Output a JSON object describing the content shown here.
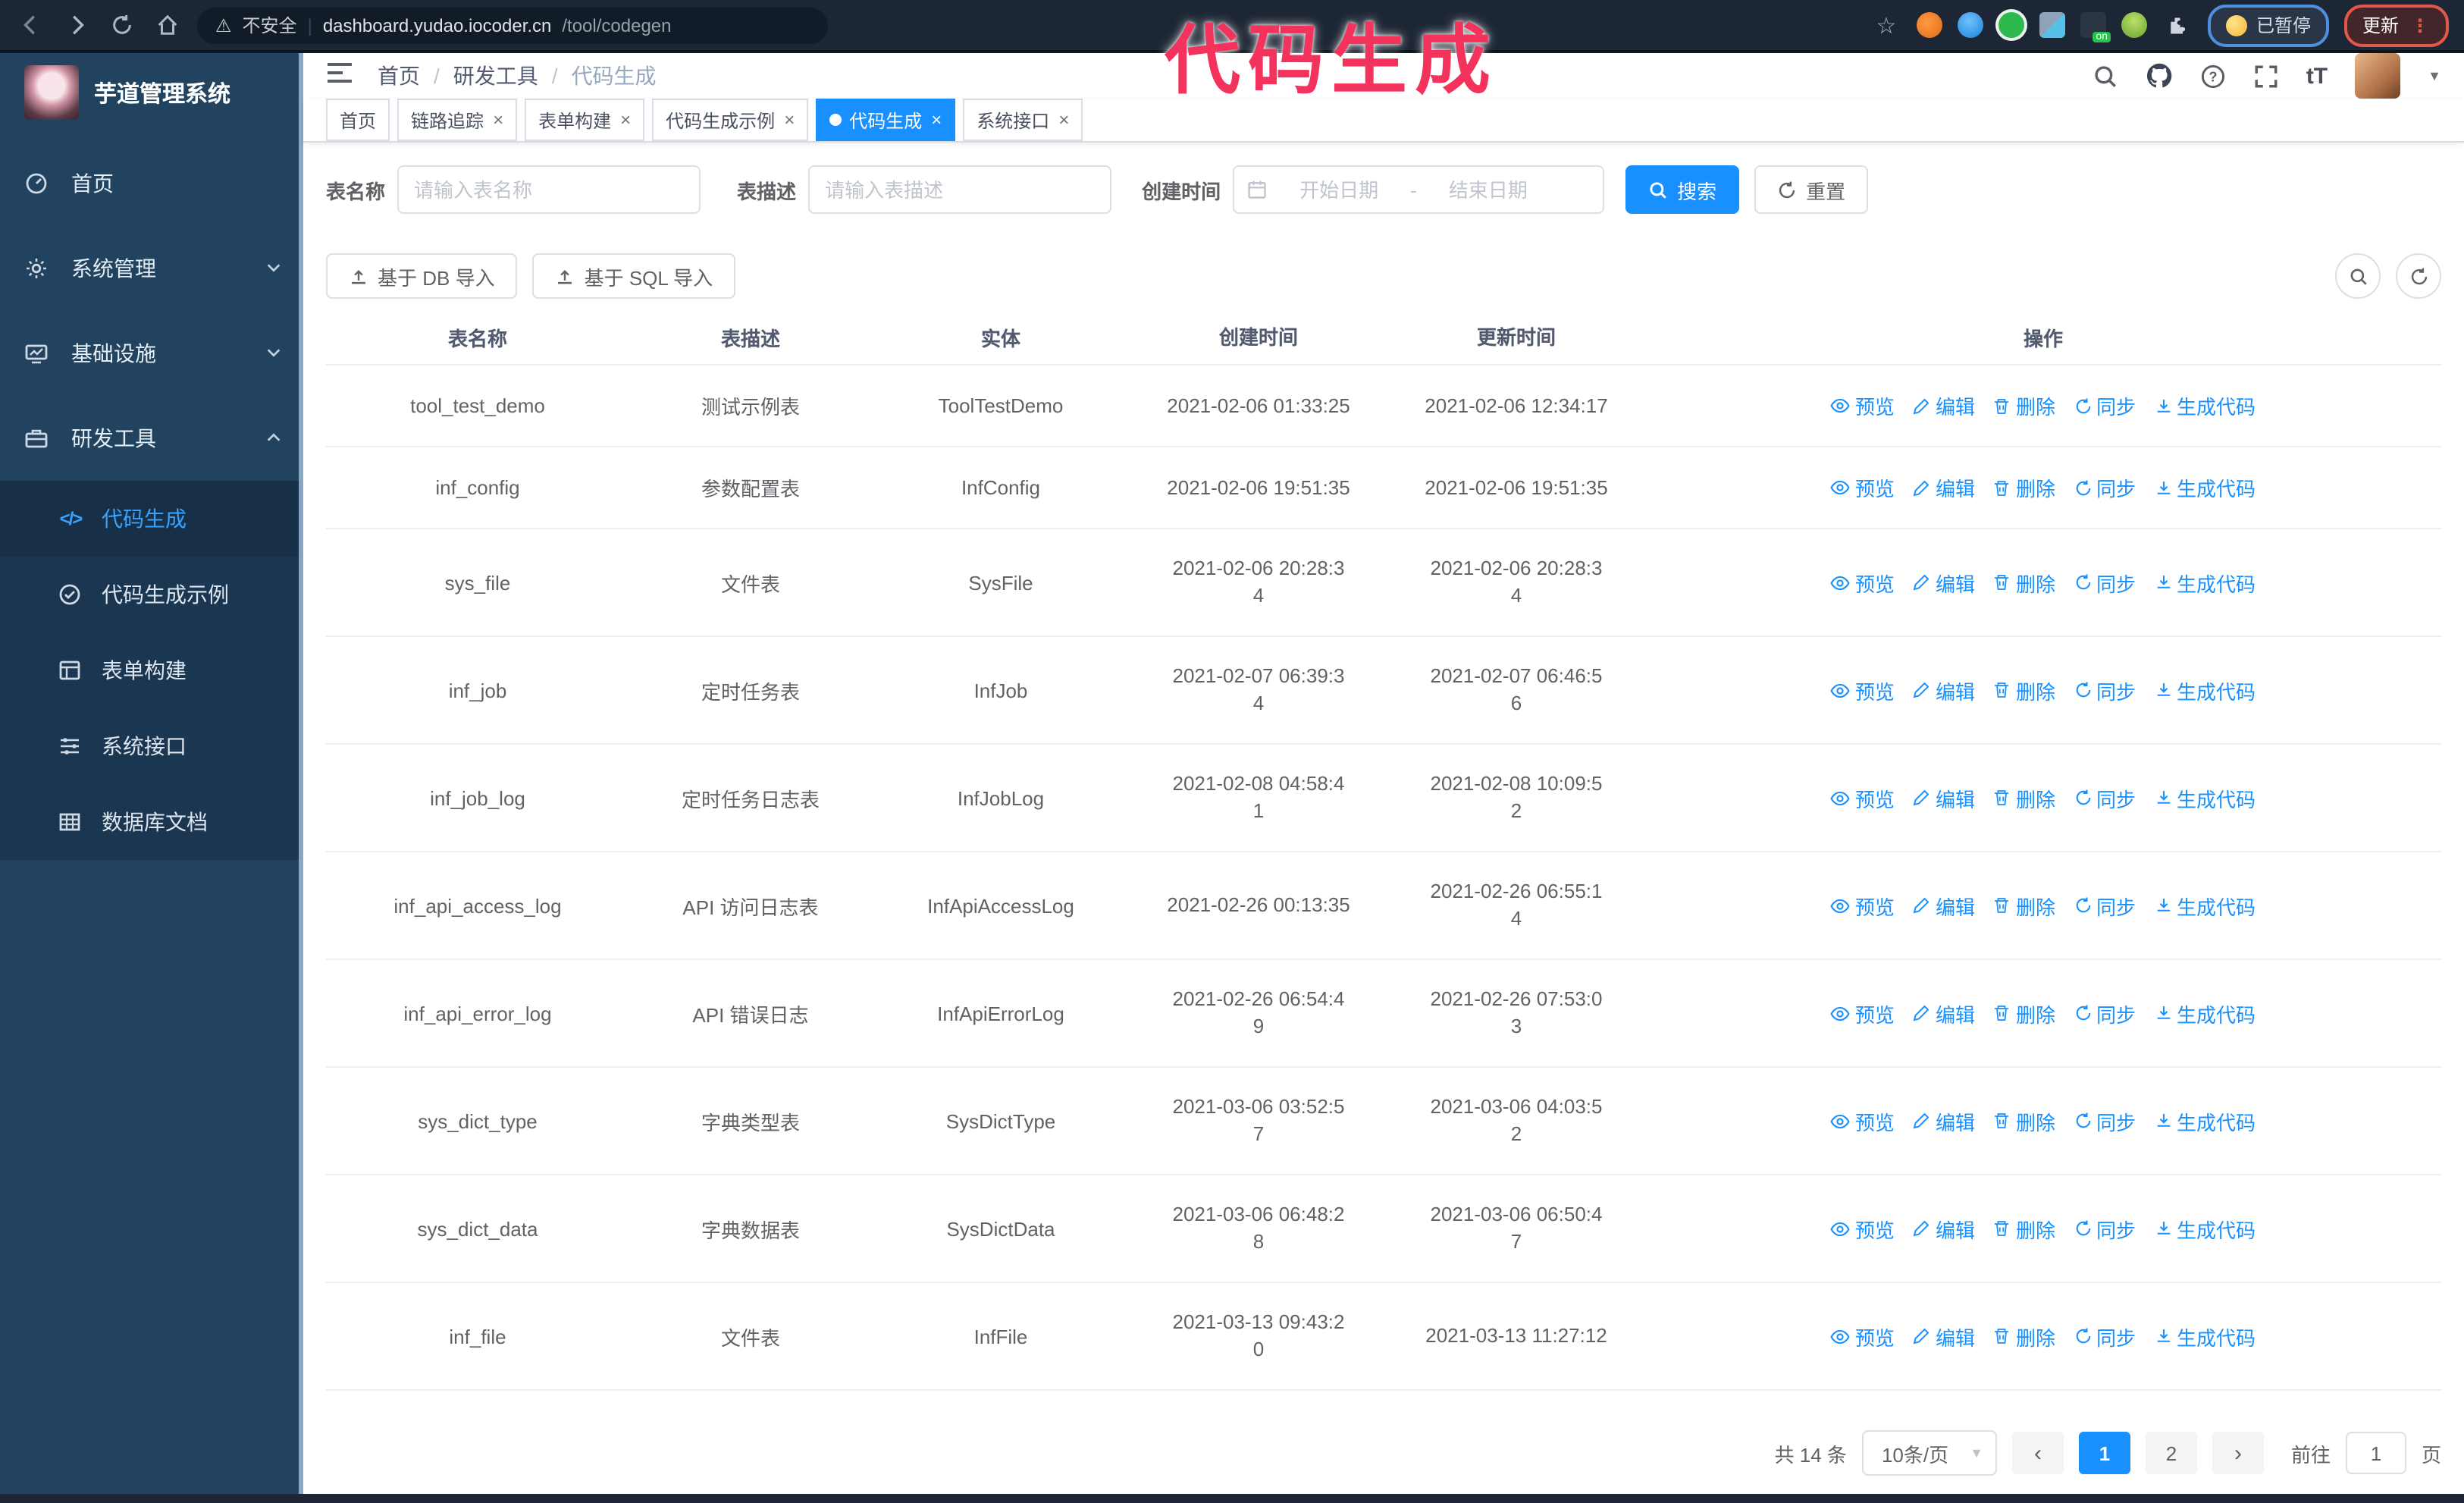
{
  "browser": {
    "security_label": "不安全",
    "url_host": "dashboard.yudao.iocoder.cn",
    "url_path": "/tool/codegen",
    "paused_badge": "已暂停",
    "update_label": "更新",
    "update_dots": "⋮"
  },
  "annotation": {
    "text": "代码生成",
    "color": "#f4335d"
  },
  "app": {
    "title": "芋道管理系统"
  },
  "header": {
    "breadcrumb": [
      "首页",
      "研发工具",
      "代码生成"
    ]
  },
  "tabs": [
    {
      "label": "首页",
      "active": false,
      "closable": false
    },
    {
      "label": "链路追踪",
      "active": false,
      "closable": true
    },
    {
      "label": "表单构建",
      "active": false,
      "closable": true
    },
    {
      "label": "代码生成示例",
      "active": false,
      "closable": true
    },
    {
      "label": "代码生成",
      "active": true,
      "closable": true
    },
    {
      "label": "系统接口",
      "active": false,
      "closable": true
    }
  ],
  "sidebar": {
    "items": [
      {
        "label": "首页"
      },
      {
        "label": "系统管理"
      },
      {
        "label": "基础设施"
      },
      {
        "label": "研发工具"
      }
    ],
    "sub_items": [
      {
        "label": "代码生成",
        "active": true
      },
      {
        "label": "代码生成示例"
      },
      {
        "label": "表单构建"
      },
      {
        "label": "系统接口"
      },
      {
        "label": "数据库文档"
      }
    ]
  },
  "filters": {
    "name_label": "表名称",
    "name_placeholder": "请输入表名称",
    "desc_label": "表描述",
    "desc_placeholder": "请输入表描述",
    "time_label": "创建时间",
    "start_placeholder": "开始日期",
    "range_separator": "-",
    "end_placeholder": "结束日期",
    "search_label": "搜索",
    "reset_label": "重置"
  },
  "toolbar": {
    "db_import_label": "基于 DB 导入",
    "sql_import_label": "基于 SQL 导入"
  },
  "table": {
    "columns": [
      "表名称",
      "表描述",
      "实体",
      "创建时间",
      "更新时间",
      "操作"
    ],
    "rows": [
      {
        "name": "tool_test_demo",
        "desc": "测试示例表",
        "entity": "ToolTestDemo",
        "created": "2021-02-06 01:33:25",
        "updated": "2021-02-06 12:34:17"
      },
      {
        "name": "inf_config",
        "desc": "参数配置表",
        "entity": "InfConfig",
        "created": "2021-02-06 19:51:35",
        "updated": "2021-02-06 19:51:35"
      },
      {
        "name": "sys_file",
        "desc": "文件表",
        "entity": "SysFile",
        "created": "2021-02-06 20:28:3\n4",
        "updated": "2021-02-06 20:28:3\n4"
      },
      {
        "name": "inf_job",
        "desc": "定时任务表",
        "entity": "InfJob",
        "created": "2021-02-07 06:39:3\n4",
        "updated": "2021-02-07 06:46:5\n6"
      },
      {
        "name": "inf_job_log",
        "desc": "定时任务日志表",
        "entity": "InfJobLog",
        "created": "2021-02-08 04:58:4\n1",
        "updated": "2021-02-08 10:09:5\n2"
      },
      {
        "name": "inf_api_access_log",
        "desc": "API 访问日志表",
        "entity": "InfApiAccessLog",
        "created": "2021-02-26 00:13:35",
        "updated": "2021-02-26 06:55:1\n4"
      },
      {
        "name": "inf_api_error_log",
        "desc": "API 错误日志",
        "entity": "InfApiErrorLog",
        "created": "2021-02-26 06:54:4\n9",
        "updated": "2021-02-26 07:53:0\n3"
      },
      {
        "name": "sys_dict_type",
        "desc": "字典类型表",
        "entity": "SysDictType",
        "created": "2021-03-06 03:52:5\n7",
        "updated": "2021-03-06 04:03:5\n2"
      },
      {
        "name": "sys_dict_data",
        "desc": "字典数据表",
        "entity": "SysDictData",
        "created": "2021-03-06 06:48:2\n8",
        "updated": "2021-03-06 06:50:4\n7"
      },
      {
        "name": "inf_file",
        "desc": "文件表",
        "entity": "InfFile",
        "created": "2021-03-13 09:43:2\n0",
        "updated": "2021-03-13 11:27:12"
      }
    ]
  },
  "actions": {
    "preview": "预览",
    "edit": "编辑",
    "delete": "删除",
    "sync": "同步",
    "generate": "生成代码"
  },
  "pagination": {
    "total": "共 14 条",
    "page_size": "10条/页",
    "pages": [
      "1",
      "2"
    ],
    "goto_label": "前往",
    "goto_value": "1",
    "page_suffix": "页"
  },
  "colors": {
    "primary": "#1890ff",
    "sidebar_bg": "#22435f",
    "annotation": "#f4335d",
    "active_tab": "#1890ff"
  }
}
